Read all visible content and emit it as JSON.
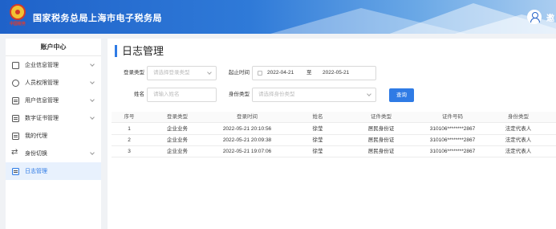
{
  "header": {
    "title": "国家税务总局上海市电子税务局",
    "logo_text": "中国税务",
    "user_name": "邀"
  },
  "sidebar": {
    "title": "账户中心",
    "items": [
      {
        "label": "企业信息管理",
        "icon": "building-icon",
        "has_chevron": true
      },
      {
        "label": "人员权限管理",
        "icon": "user-lock-icon",
        "has_chevron": true
      },
      {
        "label": "用户信息管理",
        "icon": "id-card-icon",
        "has_chevron": true
      },
      {
        "label": "数字证书管理",
        "icon": "certificate-icon",
        "has_chevron": true
      },
      {
        "label": "我的代理",
        "icon": "agent-icon",
        "has_chevron": false
      },
      {
        "label": "身份切换",
        "icon": "switch-icon",
        "has_chevron": true
      },
      {
        "label": "日志管理",
        "icon": "log-icon",
        "has_chevron": false,
        "active": true
      }
    ]
  },
  "main": {
    "title": "日志管理",
    "filters": {
      "login_type_label": "登录类型",
      "login_type_placeholder": "请选择登录类型",
      "time_label": "起止时间",
      "date_start": "2022-04-21",
      "date_separator": "至",
      "date_end": "2022-05-21",
      "name_label": "姓名",
      "name_placeholder": "请输入姓名",
      "identity_label": "身份类型",
      "identity_placeholder": "请选择身份类型",
      "query_button": "查询"
    },
    "table": {
      "columns": [
        "序号",
        "登录类型",
        "登录时间",
        "姓名",
        "证件类型",
        "证件号码",
        "身份类型"
      ],
      "rows": [
        [
          "1",
          "企业业务",
          "2022-05-21 20:10:56",
          "徐莹",
          "居民身份证",
          "310106********2867",
          "法定代表人"
        ],
        [
          "2",
          "企业业务",
          "2022-05-21 20:09:38",
          "徐莹",
          "居民身份证",
          "310106********2867",
          "法定代表人"
        ],
        [
          "3",
          "企业业务",
          "2022-05-21 19:07:06",
          "徐莹",
          "居民身份证",
          "310106********2867",
          "法定代表人"
        ]
      ]
    }
  },
  "colors": {
    "accent": "#2f7be5",
    "header_blue": "#1f62c9",
    "active_bg": "#e8f1fd"
  }
}
